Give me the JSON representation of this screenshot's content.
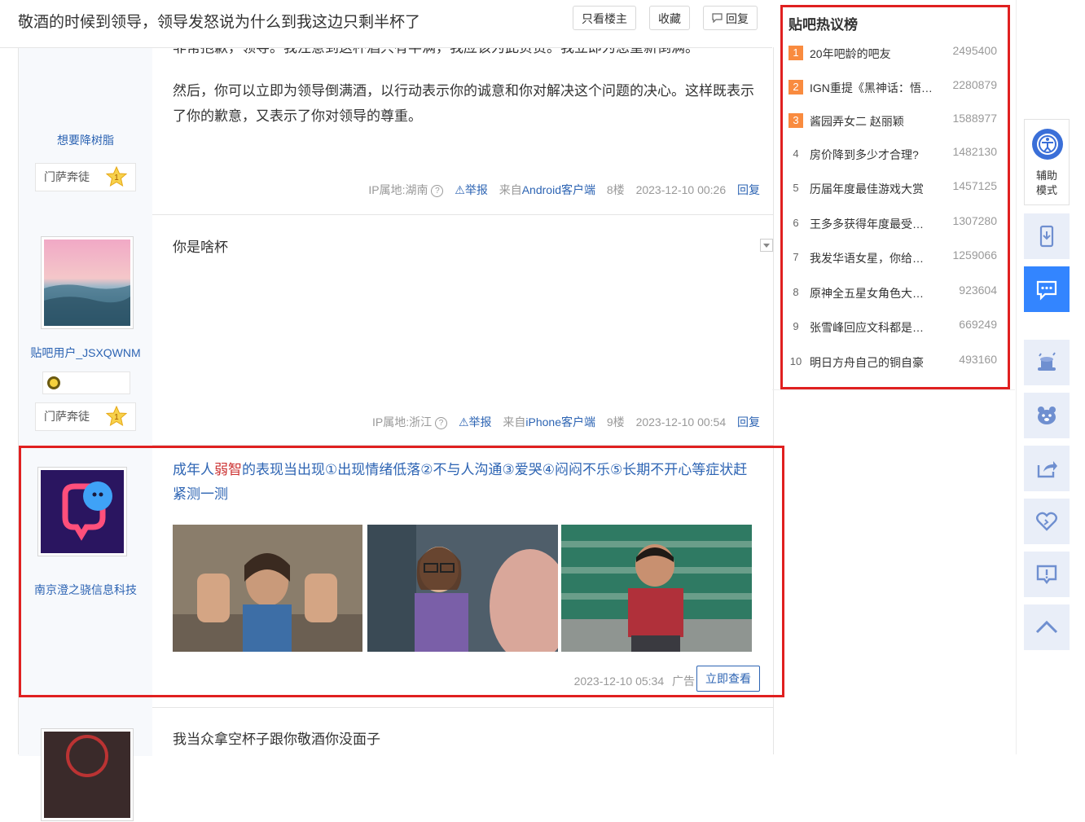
{
  "thread": {
    "title": "敬酒的时候到领导，领导发怒说为什么到我这边只剩半杯了",
    "buttons": {
      "only_op": "只看楼主",
      "favorite": "收藏",
      "reply": "回复"
    }
  },
  "posts": [
    {
      "author": "想要降树脂",
      "badge": "门萨奔徒",
      "badge_level": "1",
      "text_partial": "非常抱歉，领导。我注意到这杯酒只有半满，我应该为此负责。我立即为您重新倒满。",
      "text": "然后，你可以立即为领导倒满酒，以行动表示你的诚意和你对解决这个问题的决心。这样既表示了你的歉意，又表示了你对领导的尊重。",
      "ip": "IP属地:湖南",
      "report": "举报",
      "source_prefix": "来自",
      "source": "Android客户端",
      "floor": "8楼",
      "time": "2023-12-10 00:26",
      "reply": "回复"
    },
    {
      "author": "贴吧用户_JSXQWNM",
      "badge": "门萨奔徒",
      "badge_level": "1",
      "text": "你是啥杯",
      "ip": "IP属地:浙江",
      "report": "举报",
      "source_prefix": "来自",
      "source": "iPhone客户端",
      "floor": "9楼",
      "time": "2023-12-10 00:54",
      "reply": "回复"
    },
    {
      "author": "",
      "text": "我当众拿空杯子跟你敬酒你没面子"
    }
  ],
  "ad": {
    "author": "南京澄之骁信息科技",
    "title_before": "成年人",
    "title_highlight": "弱智",
    "title_after": "的表现当出现①出现情绪低落②不与人沟通③爱哭④闷闷不乐⑤长期不开心等症状赶紧测一测",
    "time": "2023-12-10 05:34",
    "label": "广告",
    "button": "立即查看"
  },
  "hot_list": {
    "title": "贴吧热议榜",
    "items": [
      {
        "rank": "1",
        "name": "20年吧龄的吧友",
        "count": "2495400"
      },
      {
        "rank": "2",
        "name": "IGN重提《黑神话：悟空》",
        "count": "2280879"
      },
      {
        "rank": "3",
        "name": "酱园弄女二 赵丽颖",
        "count": "1588977"
      },
      {
        "rank": "4",
        "name": "房价降到多少才合理?",
        "count": "1482130"
      },
      {
        "rank": "5",
        "name": "历届年度最佳游戏大赏",
        "count": "1457125"
      },
      {
        "rank": "6",
        "name": "王多多获得年度最受欢迎",
        "count": "1307280"
      },
      {
        "rank": "7",
        "name": "我发华语女星，你给出评价",
        "count": "1259066"
      },
      {
        "rank": "8",
        "name": "原神全五星女角色大盘点",
        "count": "923604"
      },
      {
        "rank": "9",
        "name": "张雪峰回应文科都是服务业",
        "count": "669249"
      },
      {
        "rank": "10",
        "name": "明日方舟自己的铜自豪",
        "count": "493160"
      }
    ]
  },
  "toolbar": {
    "assist_label_1": "辅助",
    "assist_label_2": "模式"
  },
  "colors": {
    "accent": "#2d64b3",
    "highlight_box": "#e02020",
    "rank_top": "#f98b3f",
    "toolbar_active": "#3385ff"
  }
}
